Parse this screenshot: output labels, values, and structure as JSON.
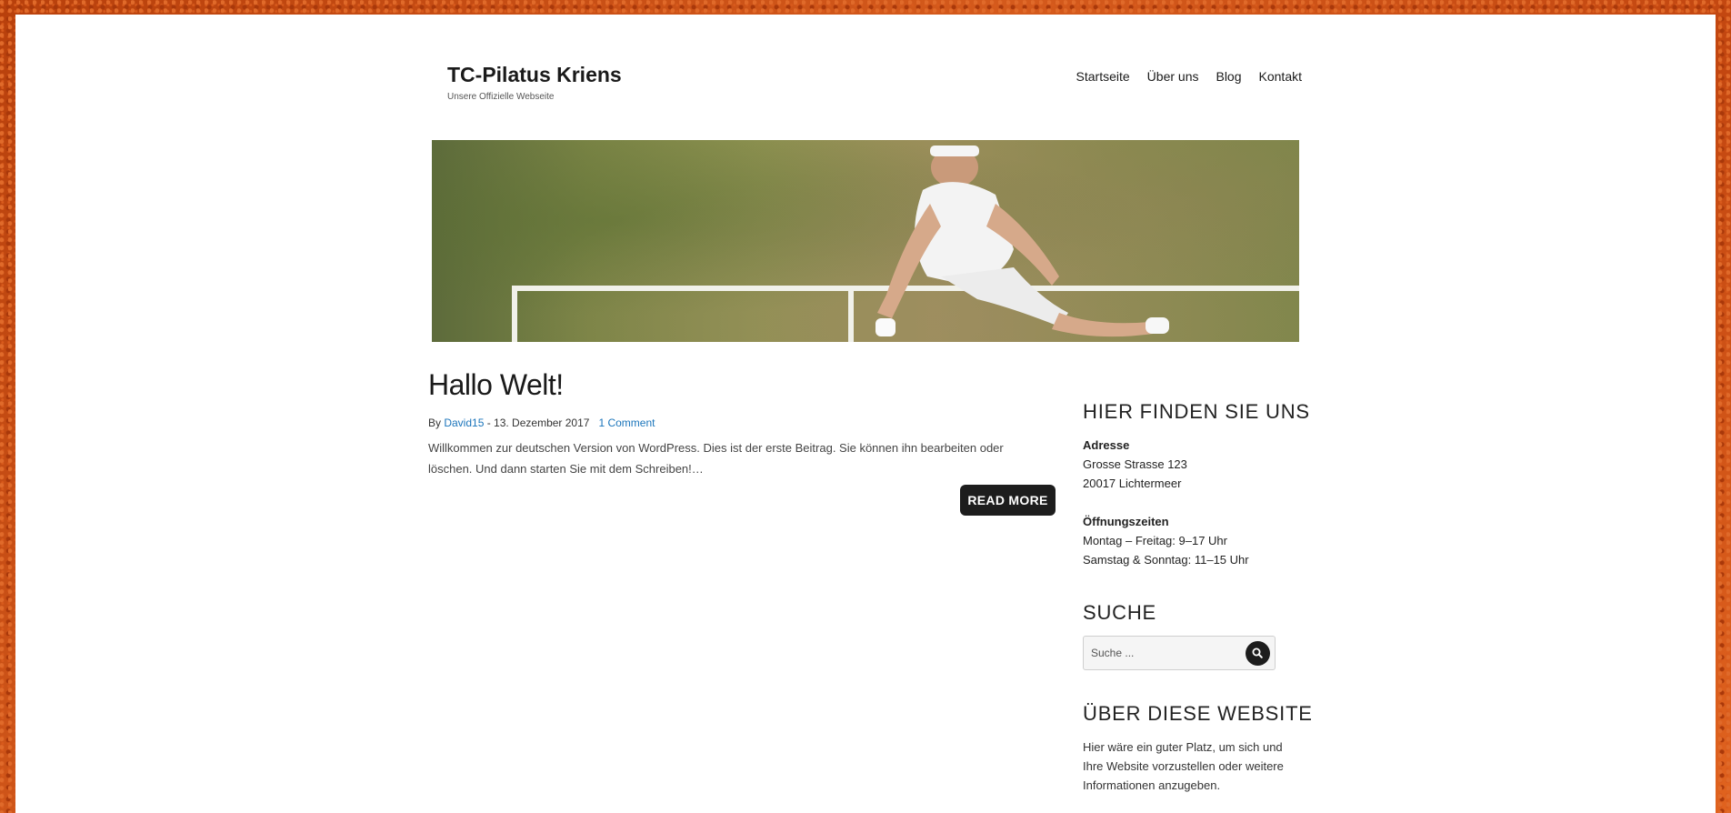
{
  "site": {
    "title": "TC-Pilatus Kriens",
    "description": "Unsere Offizielle Webseite"
  },
  "nav": {
    "items": [
      "Startseite",
      "Über uns",
      "Blog",
      "Kontakt"
    ]
  },
  "post": {
    "title": "Hallo Welt!",
    "meta_by": "By ",
    "author": "David15",
    "date": " - 13. Dezember 2017",
    "comments": "1 Comment",
    "excerpt": "Willkommen zur deutschen Version von WordPress. Dies ist der erste Beitrag. Sie können ihn bearbeiten oder löschen. Und dann starten Sie mit dem Schreiben!…",
    "read_more": "READ MORE"
  },
  "sidebar": {
    "location": {
      "title": "HIER FINDEN SIE UNS",
      "address_label": "Adresse",
      "address_line1": "Grosse Strasse 123",
      "address_line2": "20017 Lichtermeer",
      "hours_label": "Öffnungszeiten",
      "hours_line1": "Montag – Freitag: 9–17 Uhr",
      "hours_line2": "Samstag & Sonntag: 11–15 Uhr"
    },
    "search": {
      "title": "SUCHE",
      "placeholder": "Suche ..."
    },
    "about": {
      "title": "ÜBER DIESE WEBSITE",
      "text": "Hier wäre ein guter Platz, um sich und Ihre Website vorzustellen oder weitere Informationen anzugeben."
    }
  },
  "colors": {
    "background": "#c94a12",
    "link": "#1b75bb",
    "button": "#1d1d1d"
  },
  "icons": {
    "search_button": "search-icon"
  }
}
